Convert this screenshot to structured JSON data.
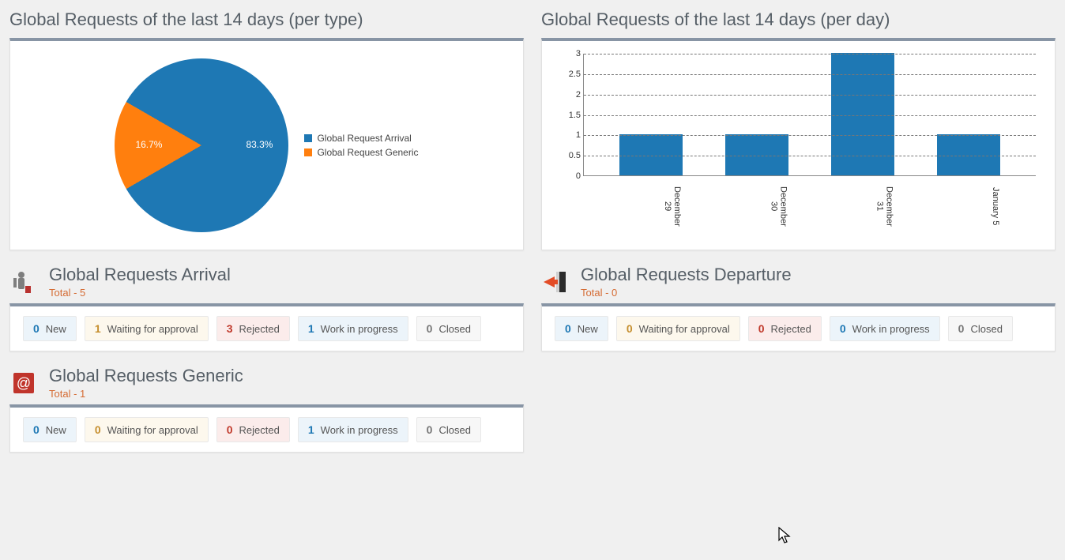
{
  "chart_data": [
    {
      "type": "pie",
      "title": "Global Requests of the last 14 days (per type)",
      "series": [
        {
          "name": "Global Request Arrival",
          "value": 83.3,
          "color": "#1e78b4"
        },
        {
          "name": "Global Request Generic",
          "value": 16.7,
          "color": "#ff7f0e"
        }
      ]
    },
    {
      "type": "bar",
      "title": "Global Requests of the last 14 days (per day)",
      "ylim": [
        0,
        3
      ],
      "yticks": [
        0,
        0.5,
        1,
        1.5,
        2,
        2.5,
        3
      ],
      "categories": [
        "December 29",
        "December 30",
        "December 31",
        "January 5"
      ],
      "values": [
        1,
        1,
        3,
        1
      ],
      "color": "#1e78b4"
    }
  ],
  "pieTitle": "Global Requests of the last 14 days (per type)",
  "barTitle": "Global Requests of the last 14 days (per day)",
  "sections": {
    "arrival": {
      "title": "Global Requests Arrival",
      "total": "Total - 5",
      "stats": {
        "new": {
          "count": "0",
          "label": "New"
        },
        "waiting": {
          "count": "1",
          "label": "Waiting for approval"
        },
        "rejected": {
          "count": "3",
          "label": "Rejected"
        },
        "work": {
          "count": "1",
          "label": "Work in progress"
        },
        "closed": {
          "count": "0",
          "label": "Closed"
        }
      }
    },
    "departure": {
      "title": "Global Requests Departure",
      "total": "Total - 0",
      "stats": {
        "new": {
          "count": "0",
          "label": "New"
        },
        "waiting": {
          "count": "0",
          "label": "Waiting for approval"
        },
        "rejected": {
          "count": "0",
          "label": "Rejected"
        },
        "work": {
          "count": "0",
          "label": "Work in progress"
        },
        "closed": {
          "count": "0",
          "label": "Closed"
        }
      }
    },
    "generic": {
      "title": "Global Requests Generic",
      "total": "Total - 1",
      "stats": {
        "new": {
          "count": "0",
          "label": "New"
        },
        "waiting": {
          "count": "0",
          "label": "Waiting for approval"
        },
        "rejected": {
          "count": "0",
          "label": "Rejected"
        },
        "work": {
          "count": "1",
          "label": "Work in progress"
        },
        "closed": {
          "count": "0",
          "label": "Closed"
        }
      }
    }
  }
}
